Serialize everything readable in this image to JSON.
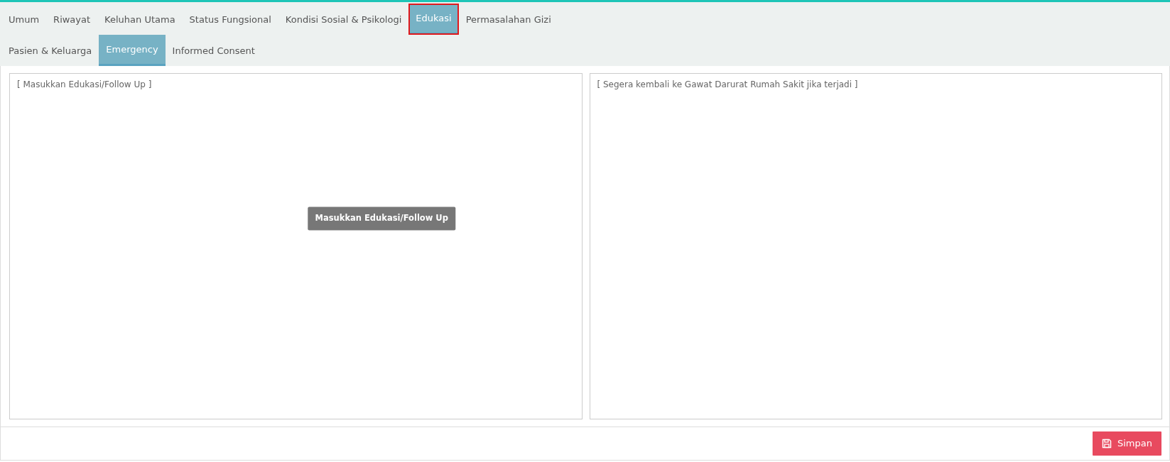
{
  "tab_rows": [
    [
      {
        "label": "Umum",
        "selected": false,
        "outlined": false
      },
      {
        "label": "Riwayat",
        "selected": false,
        "outlined": false
      },
      {
        "label": "Keluhan Utama",
        "selected": false,
        "outlined": false
      },
      {
        "label": "Status Fungsional",
        "selected": false,
        "outlined": false
      },
      {
        "label": "Kondisi Sosial & Psikologi",
        "selected": false,
        "outlined": false
      },
      {
        "label": "Edukasi",
        "selected": true,
        "outlined": true
      },
      {
        "label": "Permasalahan Gizi",
        "selected": false,
        "outlined": false
      }
    ],
    [
      {
        "label": "Pasien & Keluarga",
        "selected": false,
        "outlined": false
      },
      {
        "label": "Emergency",
        "selected": true,
        "outlined": false
      },
      {
        "label": "Informed Consent",
        "selected": false,
        "outlined": false
      }
    ]
  ],
  "fields": [
    {
      "placeholder": "[ Masukkan Edukasi/Follow Up ]",
      "tooltip": "Masukkan Edukasi/Follow Up"
    },
    {
      "placeholder": "[ Segera kembali ke Gawat Darurat Rumah Sakit jika terjadi ]"
    }
  ],
  "buttons": [
    {
      "label": "Simpan",
      "kind": "save"
    }
  ]
}
